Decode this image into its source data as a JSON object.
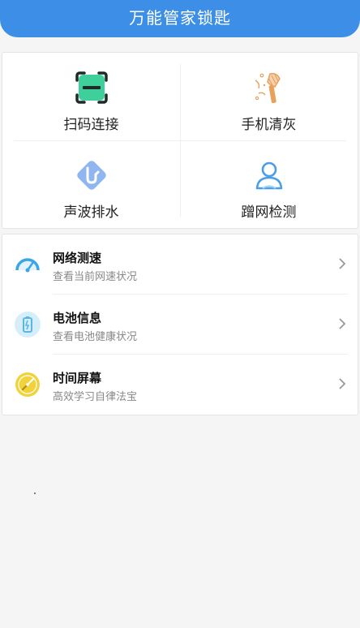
{
  "header": {
    "title": "万能管家锁匙"
  },
  "grid": {
    "items": [
      {
        "label": "扫码连接",
        "icon": "qr-scan-icon"
      },
      {
        "label": "手机清灰",
        "icon": "brush-clean-icon"
      },
      {
        "label": "声波排水",
        "icon": "sound-wave-drain-icon"
      },
      {
        "label": "蹭网检测",
        "icon": "user-detect-icon"
      }
    ]
  },
  "list": {
    "items": [
      {
        "title": "网络测速",
        "subtitle": "查看当前网速状况",
        "icon": "speedometer-icon"
      },
      {
        "title": "电池信息",
        "subtitle": "查看电池健康状况",
        "icon": "battery-icon"
      },
      {
        "title": "时间屏幕",
        "subtitle": "高效学习自律法宝",
        "icon": "compass-icon"
      }
    ]
  },
  "colors": {
    "primary": "#3d8ee6",
    "scan_green": "#3fcf9b",
    "brush_orange": "#e8a05a",
    "drain_blue": "#8fb6f0",
    "user_blue": "#4a9ee8",
    "speed_blue": "#3aa6e8",
    "battery_blue": "#5ab6e6",
    "compass_yellow": "#f2d23a"
  }
}
